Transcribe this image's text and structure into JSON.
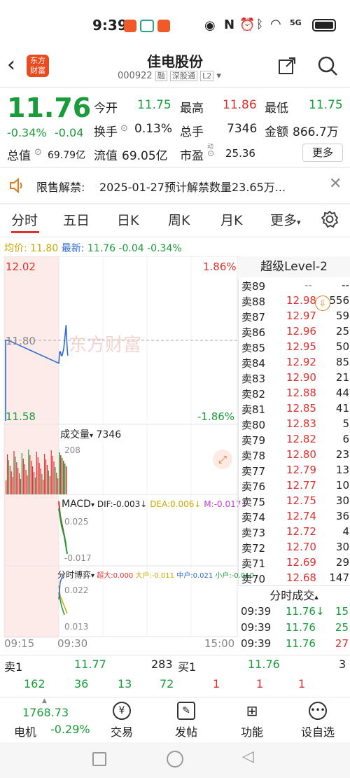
{
  "status": {
    "time": "9:39",
    "net": "5G"
  },
  "header": {
    "logo_line1": "东方",
    "logo_line2": "财富",
    "title": "佳电股份",
    "code": "000922",
    "tag1": "融",
    "tag2": "深股通",
    "tag3": "L2"
  },
  "quote": {
    "price": "11.76",
    "change_pct": "-0.34%",
    "change": "-0.04",
    "open_label": "今开",
    "open": "11.75",
    "high_label": "最高",
    "high": "11.86",
    "low_label": "最低",
    "low": "11.75",
    "turnover_label": "换手",
    "turnover": "0.13%",
    "volume_label": "总手",
    "volume": "7346",
    "amount_label": "金额",
    "amount": "866.7万",
    "mktcap_label": "总值",
    "mktcap": "69.79亿",
    "float_label": "流值",
    "float": "69.05亿",
    "pe_label": "市盈",
    "pe_sup": "动",
    "pe": "25.36",
    "more": "更多"
  },
  "notice": {
    "label": "限售解禁:",
    "text": "2025-01-27预计解禁数量23.65万..."
  },
  "tabs": [
    "分时",
    "五日",
    "日K",
    "周K",
    "月K",
    "更多"
  ],
  "chart": {
    "avg_label": "均价:",
    "avg": "11.80",
    "latest_label": "最新:",
    "latest": "11.76",
    "latest_chg": "-0.04",
    "latest_pct": "-0.34%",
    "y_top": "12.02",
    "y_mid": "11.80",
    "y_bot": "11.58",
    "pct_top": "1.86%",
    "pct_bot": "-1.86%",
    "watermark": "东方财富",
    "vol_label": "成交量",
    "vol_value": "7346",
    "vol_max": "208",
    "macd_label": "MACD",
    "dif": "DIF:-0.003↓",
    "dea": "DEA:0.006↓",
    "m": "M:-0.017↓",
    "macd_top": "0.025",
    "macd_bot": "-0.017",
    "game_label": "分时博弈",
    "super": "超大:0.000",
    "big": "大户:-0.011",
    "mid": "中户:0.021",
    "small": "小户:-0.010",
    "game_top": "0.022",
    "game_bot": "0.013",
    "t_start": "09:15",
    "t_mid": "09:30",
    "t_end": "15:00"
  },
  "chart_data": {
    "type": "line",
    "x": [
      "09:30",
      "09:31",
      "09:32",
      "09:33",
      "09:34",
      "09:35",
      "09:36",
      "09:37",
      "09:38",
      "09:39"
    ],
    "series": [
      {
        "values": [
          11.74,
          11.77,
          11.77,
          11.76,
          11.76,
          11.77,
          11.78,
          11.84,
          11.79,
          11.76
        ]
      }
    ],
    "ylim": [
      11.58,
      12.02
    ]
  },
  "book": {
    "title": "超级Level-2",
    "rows": [
      {
        "label": "卖89",
        "price": "--",
        "qty": "--"
      },
      {
        "label": "卖88",
        "price": "12.98",
        "qty": "556"
      },
      {
        "label": "卖87",
        "price": "12.97",
        "qty": "59"
      },
      {
        "label": "卖86",
        "price": "12.96",
        "qty": "25"
      },
      {
        "label": "卖85",
        "price": "12.95",
        "qty": "50"
      },
      {
        "label": "卖84",
        "price": "12.92",
        "qty": "85"
      },
      {
        "label": "卖83",
        "price": "12.90",
        "qty": "21"
      },
      {
        "label": "卖82",
        "price": "12.88",
        "qty": "44"
      },
      {
        "label": "卖81",
        "price": "12.85",
        "qty": "41"
      },
      {
        "label": "卖80",
        "price": "12.83",
        "qty": "5"
      },
      {
        "label": "卖79",
        "price": "12.82",
        "qty": "6"
      },
      {
        "label": "卖78",
        "price": "12.80",
        "qty": "23"
      },
      {
        "label": "卖77",
        "price": "12.79",
        "qty": "13"
      },
      {
        "label": "卖76",
        "price": "12.77",
        "qty": "10"
      },
      {
        "label": "卖75",
        "price": "12.75",
        "qty": "30"
      },
      {
        "label": "卖74",
        "price": "12.74",
        "qty": "36"
      },
      {
        "label": "卖73",
        "price": "12.72",
        "qty": "4"
      },
      {
        "label": "卖72",
        "price": "12.70",
        "qty": "30"
      },
      {
        "label": "卖71",
        "price": "12.69",
        "qty": "29"
      },
      {
        "label": "卖70",
        "price": "12.68",
        "qty": "147"
      }
    ],
    "trades_title": "分时成交",
    "trades": [
      {
        "time": "09:39",
        "price": "11.76↓",
        "qty": "15"
      },
      {
        "time": "09:39",
        "price": "11.76",
        "qty": "25"
      },
      {
        "time": "09:39",
        "price": "11.76",
        "qty": "27"
      }
    ]
  },
  "bids": {
    "sell1_label": "卖1",
    "sell1_price": "11.77",
    "sell1_qty": "283",
    "buy1_label": "买1",
    "buy1_price": "11.76",
    "buy1_qty": "3",
    "row2": [
      "162",
      "36",
      "13",
      "72",
      "1",
      "1",
      "1"
    ]
  },
  "nav": {
    "index_value": "1768.73",
    "index_name": "电机",
    "index_pct": "-0.29%",
    "items": [
      "交易",
      "发帖",
      "功能",
      "设自选"
    ]
  }
}
